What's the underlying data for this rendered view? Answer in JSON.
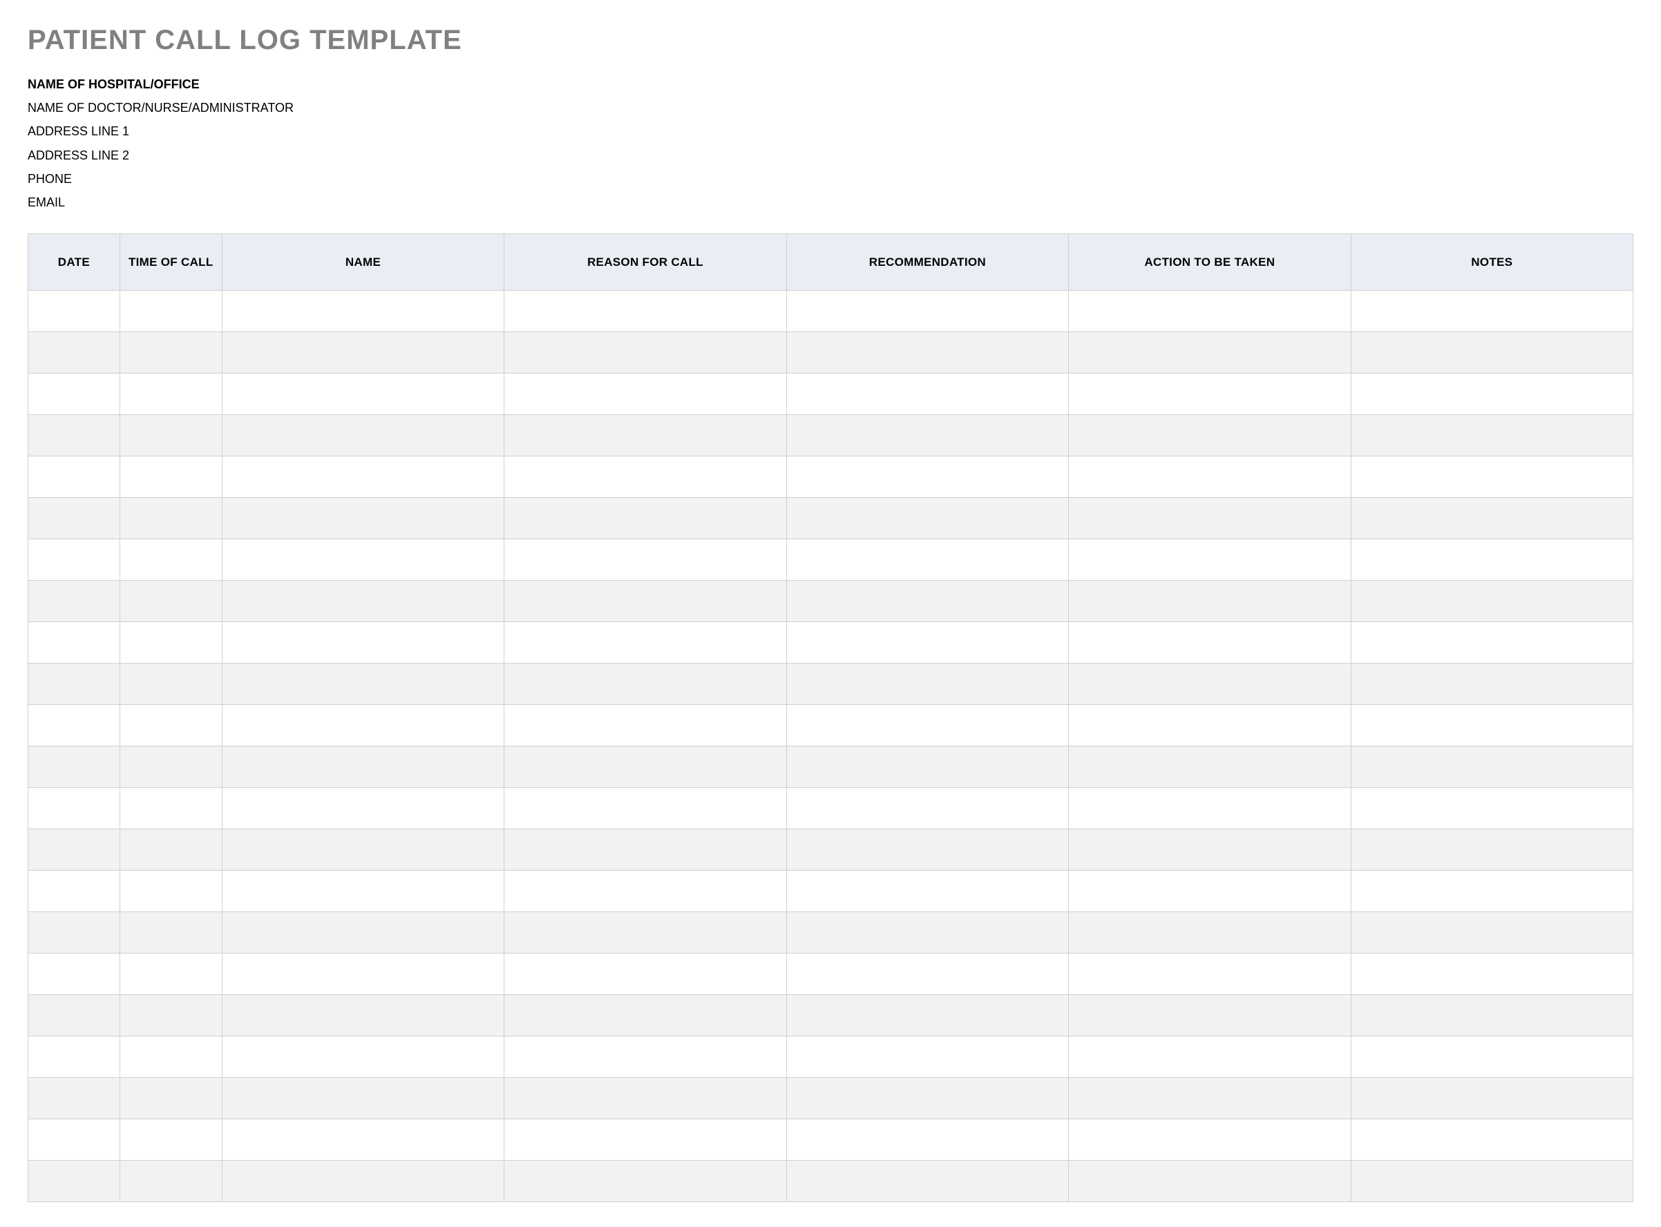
{
  "title": "PATIENT CALL LOG TEMPLATE",
  "info": {
    "hospital": "NAME OF HOSPITAL/OFFICE",
    "doctor": "NAME OF DOCTOR/NURSE/ADMINISTRATOR",
    "addr1": "ADDRESS LINE 1",
    "addr2": "ADDRESS LINE 2",
    "phone": "PHONE",
    "email": "EMAIL"
  },
  "columns": [
    "DATE",
    "TIME OF CALL",
    "NAME",
    "REASON FOR CALL",
    "RECOMMENDATION",
    "ACTION TO BE TAKEN",
    "NOTES"
  ],
  "rows": [
    [
      "",
      "",
      "",
      "",
      "",
      "",
      ""
    ],
    [
      "",
      "",
      "",
      "",
      "",
      "",
      ""
    ],
    [
      "",
      "",
      "",
      "",
      "",
      "",
      ""
    ],
    [
      "",
      "",
      "",
      "",
      "",
      "",
      ""
    ],
    [
      "",
      "",
      "",
      "",
      "",
      "",
      ""
    ],
    [
      "",
      "",
      "",
      "",
      "",
      "",
      ""
    ],
    [
      "",
      "",
      "",
      "",
      "",
      "",
      ""
    ],
    [
      "",
      "",
      "",
      "",
      "",
      "",
      ""
    ],
    [
      "",
      "",
      "",
      "",
      "",
      "",
      ""
    ],
    [
      "",
      "",
      "",
      "",
      "",
      "",
      ""
    ],
    [
      "",
      "",
      "",
      "",
      "",
      "",
      ""
    ],
    [
      "",
      "",
      "",
      "",
      "",
      "",
      ""
    ],
    [
      "",
      "",
      "",
      "",
      "",
      "",
      ""
    ],
    [
      "",
      "",
      "",
      "",
      "",
      "",
      ""
    ],
    [
      "",
      "",
      "",
      "",
      "",
      "",
      ""
    ],
    [
      "",
      "",
      "",
      "",
      "",
      "",
      ""
    ],
    [
      "",
      "",
      "",
      "",
      "",
      "",
      ""
    ],
    [
      "",
      "",
      "",
      "",
      "",
      "",
      ""
    ],
    [
      "",
      "",
      "",
      "",
      "",
      "",
      ""
    ],
    [
      "",
      "",
      "",
      "",
      "",
      "",
      ""
    ],
    [
      "",
      "",
      "",
      "",
      "",
      "",
      ""
    ],
    [
      "",
      "",
      "",
      "",
      "",
      "",
      ""
    ]
  ]
}
